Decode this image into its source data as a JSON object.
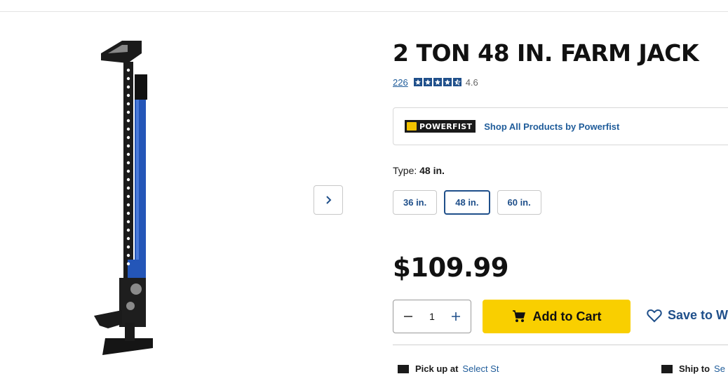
{
  "product": {
    "title": "2 TON 48 IN. FARM JACK",
    "review_count": "226",
    "rating": "4.6",
    "rating_stars": 4.6,
    "brand_logo_text": "POWERFIST",
    "brand_link": "Shop All Products by Powerfist",
    "type_label": "Type:",
    "type_selected": "48 in.",
    "type_options": [
      "36 in.",
      "48 in.",
      "60 in."
    ],
    "price": "$109.99",
    "quantity": "1",
    "add_to_cart": "Add to Cart",
    "save_wishlist": "Save to Wi",
    "pickup_label": "Pick up at",
    "pickup_link": "Select St",
    "ship_label": "Ship to",
    "ship_link": "Se"
  },
  "colors": {
    "accent_blue": "#1f4f8a",
    "link_blue": "#1f5c9a",
    "cart_yellow": "#f9cf00",
    "jack_blue": "#2456b8"
  },
  "icons": {
    "next": "chevron-right-icon",
    "minus": "minus-icon",
    "plus": "plus-icon",
    "cart": "cart-icon",
    "wishlist": "heart-icon",
    "pickup": "store-icon",
    "ship": "truck-icon"
  }
}
